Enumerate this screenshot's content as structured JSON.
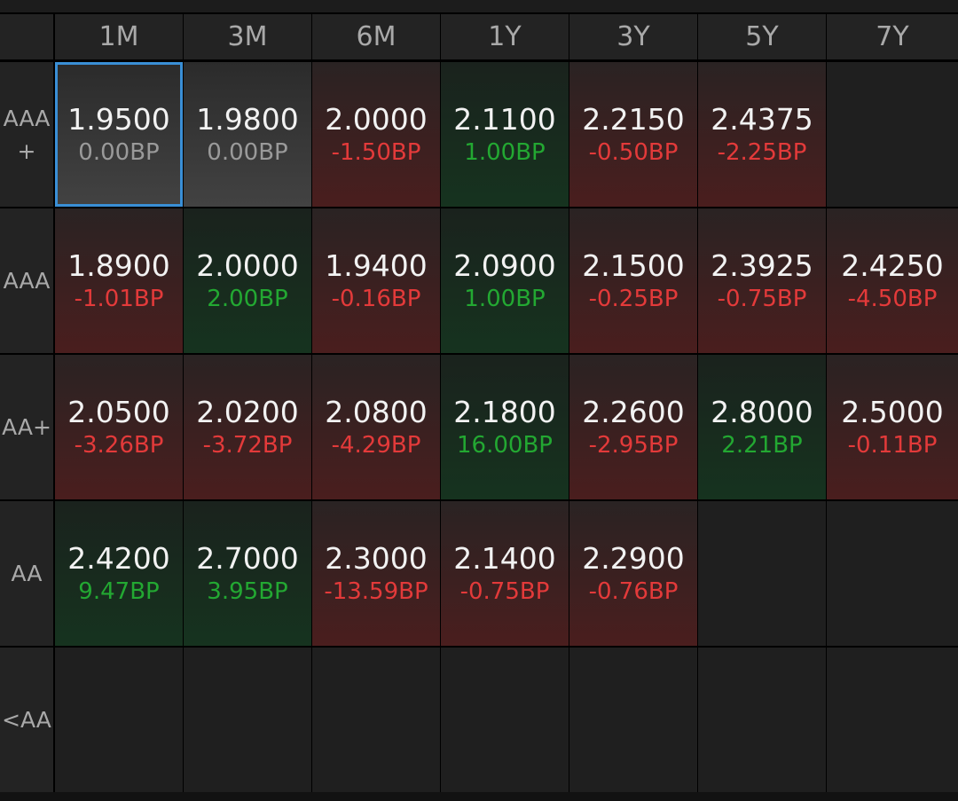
{
  "columns": [
    "1M",
    "3M",
    "6M",
    "1Y",
    "3Y",
    "5Y",
    "7Y"
  ],
  "rows": [
    {
      "label": "AAA+",
      "cells": [
        {
          "rate": "1.9500",
          "change": "0.00BP",
          "dir": "flat",
          "selected": true
        },
        {
          "rate": "1.9800",
          "change": "0.00BP",
          "dir": "flat"
        },
        {
          "rate": "2.0000",
          "change": "-1.50BP",
          "dir": "down"
        },
        {
          "rate": "2.1100",
          "change": "1.00BP",
          "dir": "up"
        },
        {
          "rate": "2.2150",
          "change": "-0.50BP",
          "dir": "down"
        },
        {
          "rate": "2.4375",
          "change": "-2.25BP",
          "dir": "down"
        },
        null
      ]
    },
    {
      "label": "AAA",
      "cells": [
        {
          "rate": "1.8900",
          "change": "-1.01BP",
          "dir": "down"
        },
        {
          "rate": "2.0000",
          "change": "2.00BP",
          "dir": "up"
        },
        {
          "rate": "1.9400",
          "change": "-0.16BP",
          "dir": "down"
        },
        {
          "rate": "2.0900",
          "change": "1.00BP",
          "dir": "up"
        },
        {
          "rate": "2.1500",
          "change": "-0.25BP",
          "dir": "down"
        },
        {
          "rate": "2.3925",
          "change": "-0.75BP",
          "dir": "down"
        },
        {
          "rate": "2.4250",
          "change": "-4.50BP",
          "dir": "down"
        }
      ]
    },
    {
      "label": "AA+",
      "cells": [
        {
          "rate": "2.0500",
          "change": "-3.26BP",
          "dir": "down"
        },
        {
          "rate": "2.0200",
          "change": "-3.72BP",
          "dir": "down"
        },
        {
          "rate": "2.0800",
          "change": "-4.29BP",
          "dir": "down"
        },
        {
          "rate": "2.1800",
          "change": "16.00BP",
          "dir": "up"
        },
        {
          "rate": "2.2600",
          "change": "-2.95BP",
          "dir": "down"
        },
        {
          "rate": "2.8000",
          "change": "2.21BP",
          "dir": "up"
        },
        {
          "rate": "2.5000",
          "change": "-0.11BP",
          "dir": "down"
        }
      ]
    },
    {
      "label": "AA",
      "cells": [
        {
          "rate": "2.4200",
          "change": "9.47BP",
          "dir": "up"
        },
        {
          "rate": "2.7000",
          "change": "3.95BP",
          "dir": "up"
        },
        {
          "rate": "2.3000",
          "change": "-13.59BP",
          "dir": "down"
        },
        {
          "rate": "2.1400",
          "change": "-0.75BP",
          "dir": "down"
        },
        {
          "rate": "2.2900",
          "change": "-0.76BP",
          "dir": "down"
        },
        null,
        null
      ]
    },
    {
      "label": "<AA",
      "cells": [
        null,
        null,
        null,
        null,
        null,
        null,
        null
      ]
    }
  ],
  "colors": {
    "up": "#23a832",
    "down": "#e33a3a",
    "flat": "#9a9a9a",
    "selection": "#3a8fd6"
  }
}
